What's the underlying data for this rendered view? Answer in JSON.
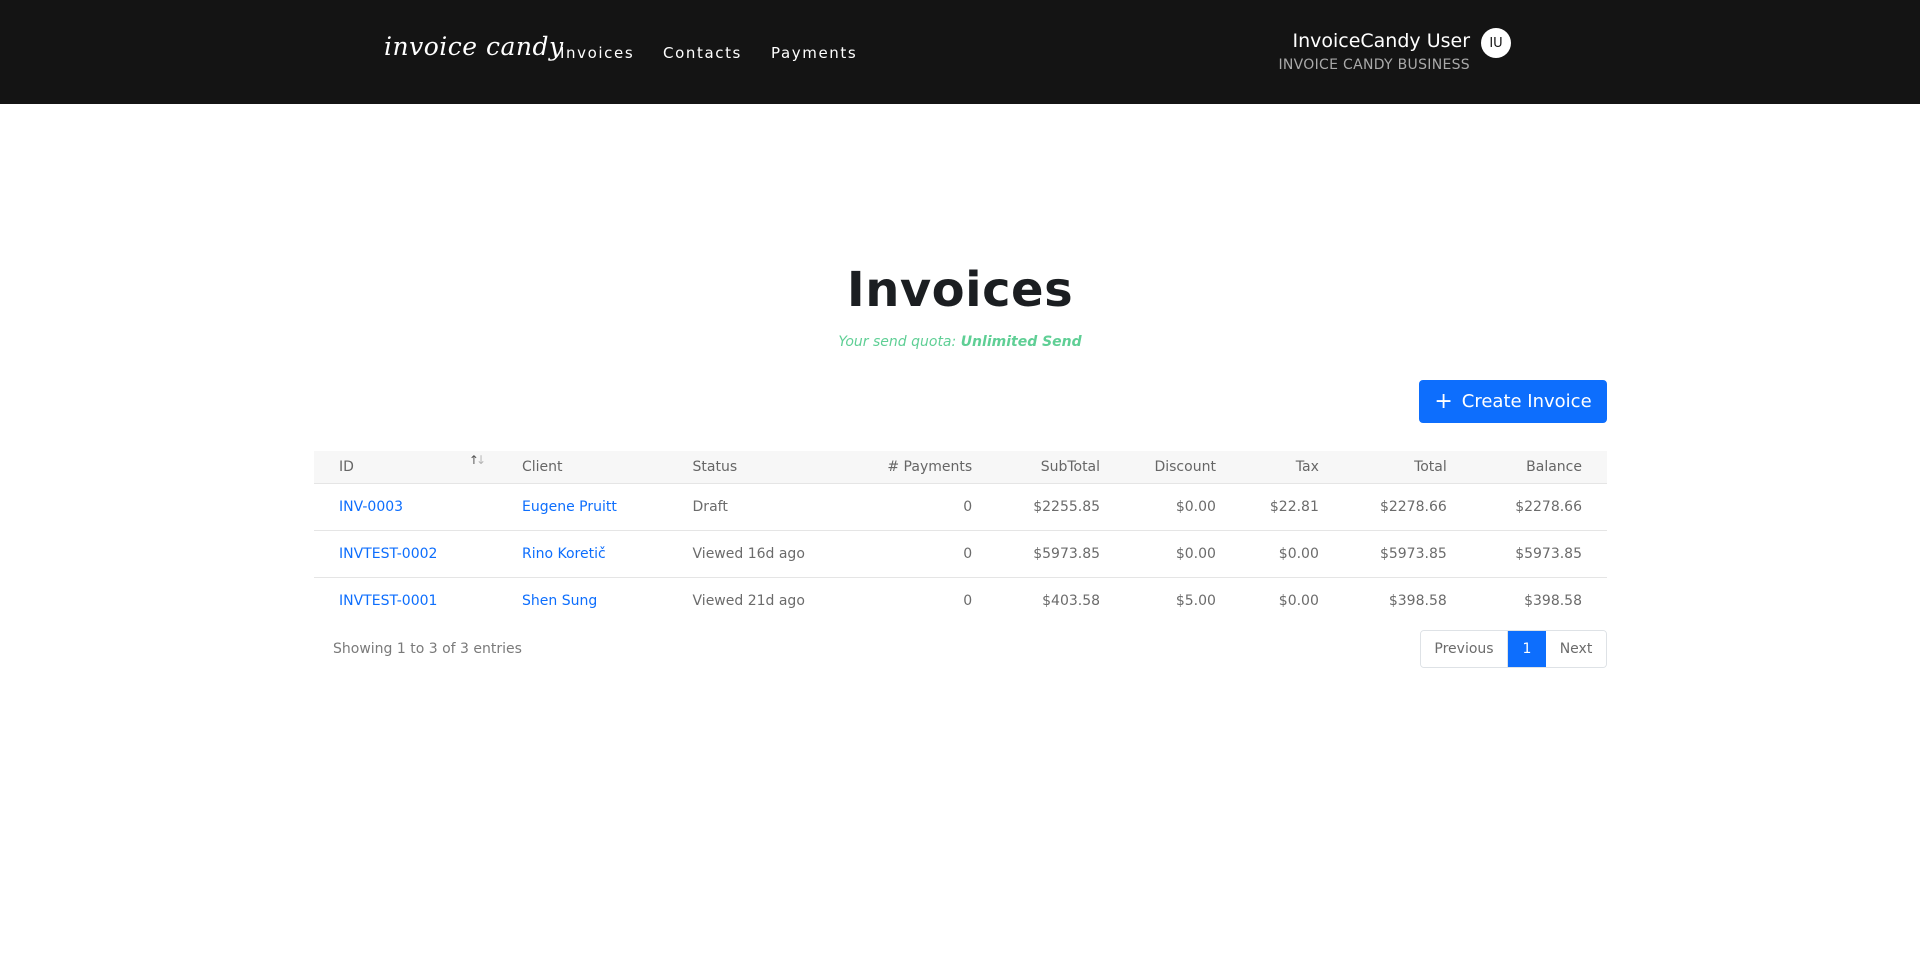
{
  "header": {
    "logo": "invoice candy",
    "nav": [
      "Invoices",
      "Contacts",
      "Payments"
    ],
    "user_name": "InvoiceCandy User",
    "business_name": "INVOICE CANDY BUSINESS",
    "avatar_initials": "IU"
  },
  "main": {
    "title": "Invoices",
    "quota_label": "Your send quota:",
    "quota_value": "Unlimited Send",
    "create_button": "Create Invoice"
  },
  "table": {
    "columns": [
      "ID",
      "Client",
      "Status",
      "# Payments",
      "SubTotal",
      "Discount",
      "Tax",
      "Total",
      "Balance"
    ],
    "rows": [
      {
        "id": "INV-0003",
        "client": "Eugene Pruitt",
        "status": "Draft",
        "payments": "0",
        "subtotal": "$2255.85",
        "discount": "$0.00",
        "tax": "$22.81",
        "total": "$2278.66",
        "balance": "$2278.66"
      },
      {
        "id": "INVTEST-0002",
        "client": "Rino Koretič",
        "status": "Viewed 16d ago",
        "payments": "0",
        "subtotal": "$5973.85",
        "discount": "$0.00",
        "tax": "$0.00",
        "total": "$5973.85",
        "balance": "$5973.85"
      },
      {
        "id": "INVTEST-0001",
        "client": "Shen Sung",
        "status": "Viewed 21d ago",
        "payments": "0",
        "subtotal": "$403.58",
        "discount": "$5.00",
        "tax": "$0.00",
        "total": "$398.58",
        "balance": "$398.58"
      }
    ]
  },
  "footer": {
    "entries_info": "Showing 1 to 3 of 3 entries",
    "previous": "Previous",
    "current_page": "1",
    "next": "Next"
  },
  "colors": {
    "topbar": "#141414",
    "accent": "#0d6efd",
    "quota": "#5fcf95"
  }
}
